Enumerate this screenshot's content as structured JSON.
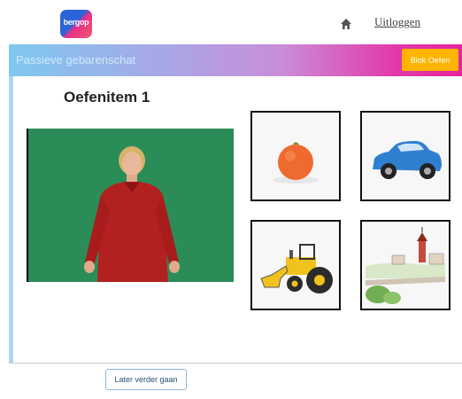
{
  "header": {
    "logo_text": "bergop",
    "home_icon": "home-icon",
    "logout_label": "Uitloggen"
  },
  "banner": {
    "title": "Passieve gebarenschat",
    "exit_label": "Blok Oefen",
    "exit_color": "#ffb400"
  },
  "exercise": {
    "title": "Oefenitem 1",
    "choices": [
      "orange-image",
      "car-image",
      "tractor-image",
      "village-image"
    ]
  },
  "footer": {
    "later_label": "Later verder gaan"
  }
}
